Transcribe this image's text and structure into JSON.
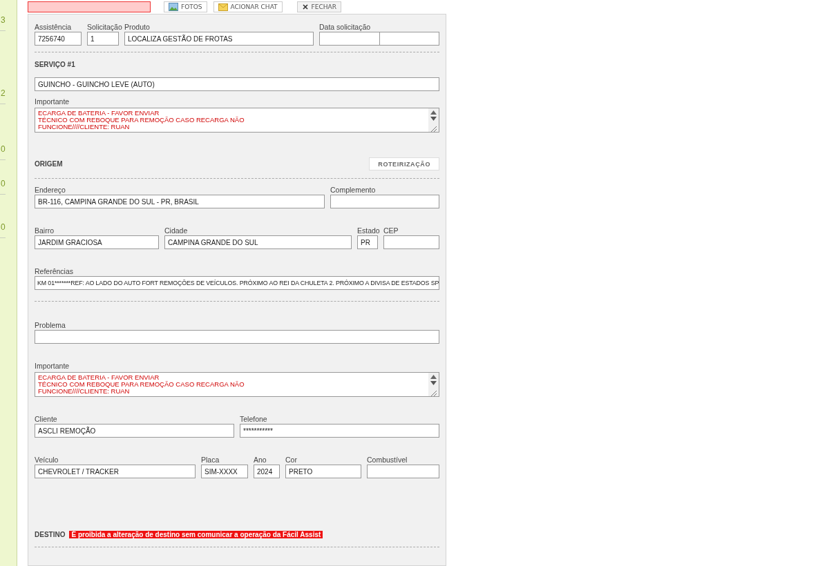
{
  "sidebar": {
    "counts": [
      "3",
      "2",
      "0",
      "0",
      "0"
    ]
  },
  "toolbar": {
    "buttons": [
      {
        "label": "FOTOS",
        "kind": "photo"
      },
      {
        "label": "ACIONAR CHAT",
        "kind": "chat"
      },
      {
        "label": "FECHAR",
        "kind": "close"
      }
    ]
  },
  "form": {
    "blocks": [
      {
        "kind": "fields",
        "fields": [
          {
            "label": "Assistência",
            "value": "7256740",
            "kind": "text"
          },
          {
            "label": "Solicitação",
            "value": "1",
            "kind": "text"
          },
          {
            "label": "Produto",
            "value": "LOCALIZA GESTÃO DE FROTAS",
            "kind": "text"
          },
          {
            "label": "Data solicitação",
            "kind": "split"
          }
        ]
      },
      {
        "kind": "divider"
      },
      {
        "kind": "title",
        "text": "SERVIÇO #1"
      },
      {
        "kind": "fields",
        "fields": [
          {
            "value": "GUINCHO - GUINCHO LEVE (AUTO)",
            "kind": "text"
          }
        ]
      },
      {
        "kind": "fields",
        "fields": [
          {
            "label": "Importante",
            "value": "ECARGA DE BATERIA - FAVOR ENVIAR\nTÉCNICO COM REBOQUE PARA REMOÇÃO CASO RECARGA NÃO\nFUNCIONE////CLIENTE: RUAN",
            "kind": "textarea"
          }
        ]
      },
      {
        "kind": "title",
        "text": "ORIGEM",
        "action": "ROTEIRIZAÇÃO"
      },
      {
        "kind": "divider"
      },
      {
        "kind": "fields",
        "fields": [
          {
            "label": "Endereço",
            "value": "BR-116, CAMPINA GRANDE DO SUL - PR, BRASIL",
            "kind": "text"
          },
          {
            "label": "Complemento",
            "kind": "text"
          }
        ]
      },
      {
        "kind": "fields",
        "fields": [
          {
            "label": "Bairro",
            "value": "JARDIM GRACIOSA",
            "kind": "text"
          },
          {
            "label": "Cidade",
            "value": "CAMPINA GRANDE DO SUL",
            "kind": "text"
          },
          {
            "label": "Estado",
            "value": "PR",
            "kind": "text"
          },
          {
            "label": "CEP",
            "kind": "text"
          }
        ]
      },
      {
        "kind": "fields",
        "fields": [
          {
            "label": "Referências",
            "value": "KM 01*******REF: AO LADO DO AUTO FORT REMOÇÕES DE VEÍCULOS. PRÓXIMO AO REI DA CHULETA 2. PRÓXIMO A DIVISA DE ESTADOS SP",
            "kind": "text"
          }
        ]
      },
      {
        "kind": "divider"
      },
      {
        "kind": "fields",
        "fields": [
          {
            "label": "Problema",
            "kind": "text"
          }
        ]
      },
      {
        "kind": "fields",
        "fields": [
          {
            "label": "Importante",
            "value": "ECARGA DE BATERIA - FAVOR ENVIAR\nTÉCNICO COM REBOQUE PARA REMOÇÃO CASO RECARGA NÃO\nFUNCIONE////CLIENTE: RUAN",
            "kind": "textarea"
          }
        ]
      },
      {
        "kind": "fields",
        "fields": [
          {
            "label": "Cliente",
            "value": "ASCLI REMOÇÃO",
            "kind": "text"
          },
          {
            "label": "Telefone",
            "value": "***********",
            "kind": "text"
          }
        ]
      },
      {
        "kind": "fields",
        "fields": [
          {
            "label": "Veículo",
            "value": "CHEVROLET / TRACKER",
            "kind": "text"
          },
          {
            "label": "Placa",
            "value": "SIM-XXXX",
            "kind": "text"
          },
          {
            "label": "Ano",
            "value": "2024",
            "kind": "text"
          },
          {
            "label": "Cor",
            "value": "PRETO",
            "kind": "text"
          },
          {
            "label": "Combustível",
            "kind": "text"
          }
        ]
      },
      {
        "kind": "title",
        "text": "DESTINO",
        "warning": "É proibida a alteração de destino sem comunicar a operação da Fácil Assist"
      },
      {
        "kind": "divider"
      }
    ]
  }
}
